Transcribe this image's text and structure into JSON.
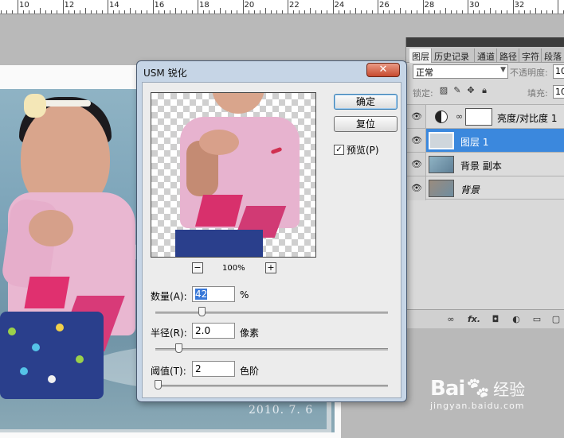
{
  "ruler": {
    "numbers": [
      "10",
      "12",
      "14",
      "16",
      "18",
      "20",
      "22",
      "24",
      "26",
      "28",
      "30",
      "32"
    ]
  },
  "photo": {
    "date_stamp": "2010. 7. 6"
  },
  "layers_panel": {
    "tabs": [
      "图层",
      "历史记录",
      "通道",
      "路径",
      "字符",
      "段落"
    ],
    "active_tab": "图层",
    "blend_mode": "正常",
    "opacity_label": "不透明度:",
    "opacity_value": "10",
    "lock_label": "锁定:",
    "fill_label": "填充:",
    "fill_value": "10",
    "layers": [
      {
        "name": "亮度/对比度 1",
        "type": "adjustment",
        "selected": false
      },
      {
        "name": "图层 1",
        "type": "pixel",
        "selected": true
      },
      {
        "name": "背景 副本",
        "type": "pixel",
        "selected": false
      },
      {
        "name": "背景",
        "type": "background",
        "selected": false
      }
    ],
    "bottom_icons": [
      "link-icon",
      "fx-icon",
      "mask-icon",
      "adjustment-icon",
      "group-icon",
      "new-layer-icon"
    ],
    "fx_label": "fx."
  },
  "dialog": {
    "title": "USM 锐化",
    "close_label": "✕",
    "ok_label": "确定",
    "reset_label": "复位",
    "preview_label": "预览(P)",
    "preview_checked": true,
    "zoom_minus": "−",
    "zoom_plus": "+",
    "zoom_level": "100%",
    "amount": {
      "label": "数量(A):",
      "value": "42",
      "unit": "%",
      "slider_fraction": 0.2
    },
    "radius": {
      "label": "半径(R):",
      "value": "2.0",
      "unit": "像素",
      "slider_fraction": 0.1
    },
    "threshold": {
      "label": "阈值(T):",
      "value": "2",
      "unit": "色阶",
      "slider_fraction": 0.01
    }
  },
  "watermark": {
    "logo": "Bai",
    "logo_suffix": "经验",
    "url": "jingyan.baidu.com"
  }
}
